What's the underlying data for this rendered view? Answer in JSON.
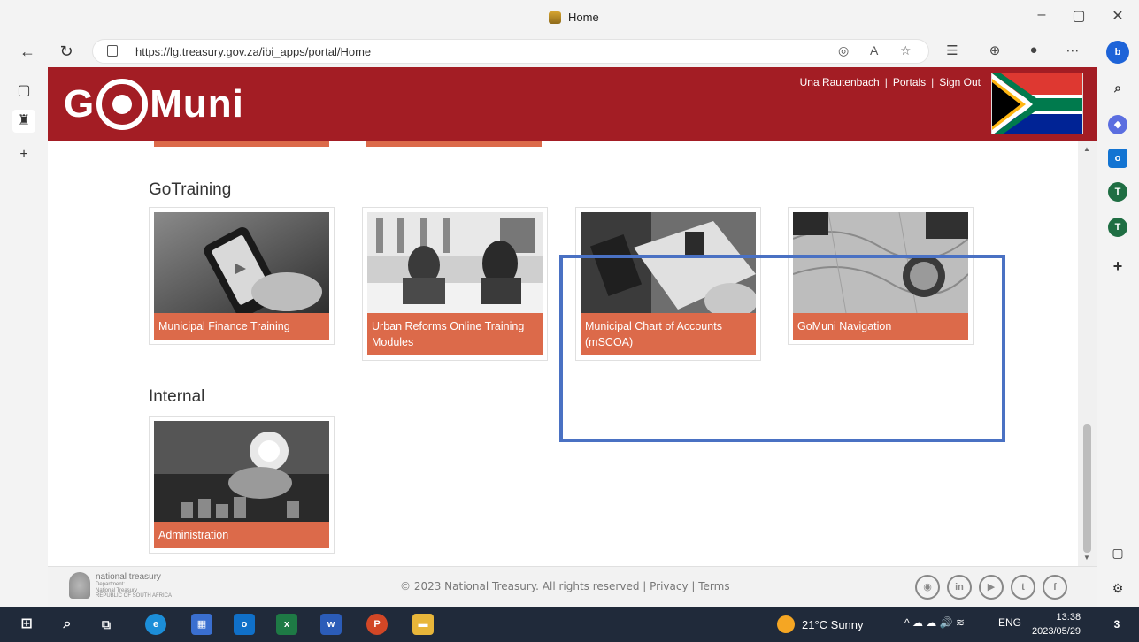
{
  "browser": {
    "tab_title": "Home",
    "url": "https://lg.treasury.gov.za/ibi_apps/portal/Home",
    "minimize": "–",
    "maximize": "▢",
    "close": "✕"
  },
  "site": {
    "logo_left": "G",
    "logo_right": "Muni",
    "user_name": "Una Rautenbach",
    "sep1": "|",
    "portals": "Portals",
    "sep2": "|",
    "sign_out": "Sign Out"
  },
  "sections": {
    "gotraining": {
      "title": "GoTraining",
      "cards": [
        {
          "label": "Municipal Finance Training"
        },
        {
          "label": "Urban Reforms Online Training Modules"
        },
        {
          "label": "Municipal Chart of Accounts (mSCOA)"
        },
        {
          "label": "GoMuni Navigation"
        }
      ]
    },
    "internal": {
      "title": "Internal",
      "cards": [
        {
          "label": "Administration"
        }
      ]
    }
  },
  "footer": {
    "org_name": "national treasury",
    "org_sub1": "Department:",
    "org_sub2": "National Treasury",
    "org_sub3": "REPUBLIC OF SOUTH AFRICA",
    "copyright": "© 2023 National Treasury. All rights reserved | Privacy | Terms",
    "social": [
      "rss",
      "in",
      "yt",
      "tw",
      "f"
    ]
  },
  "taskbar": {
    "weather": "21°C  Sunny",
    "lang": "ENG",
    "time": "13:38",
    "date": "2023/05/29",
    "notifications": "3"
  },
  "colors": {
    "header_red": "#a31d24",
    "card_orange": "#dc6a4a",
    "highlight_blue": "#4a71c3"
  }
}
